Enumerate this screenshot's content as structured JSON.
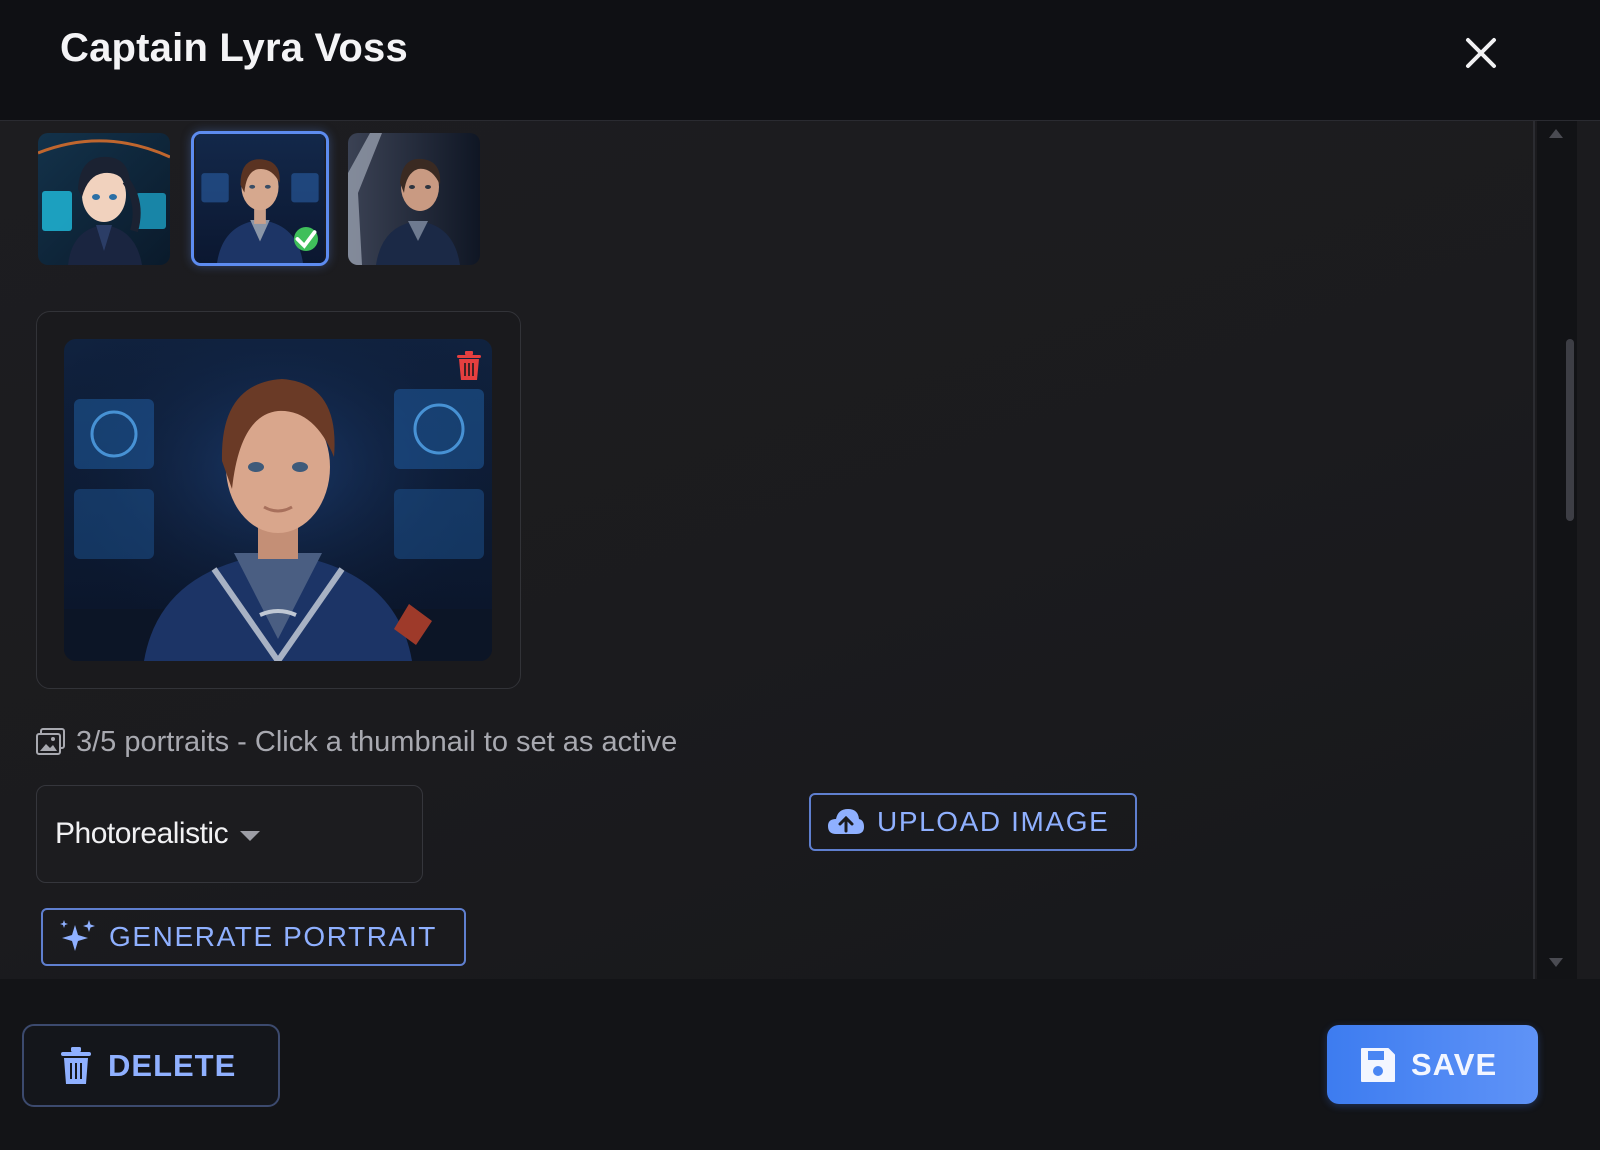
{
  "dialog": {
    "title": "Captain Lyra Voss",
    "close_icon": "close-icon"
  },
  "portraits": {
    "thumbnails": [
      {
        "style": "anime",
        "active": false
      },
      {
        "style": "photorealistic",
        "active": true
      },
      {
        "style": "cinematic",
        "active": false
      }
    ],
    "count_text": "3/5 portraits - Click a thumbnail to set as active",
    "count_icon": "image-gallery-icon",
    "delete_icon": "trash-icon"
  },
  "style_select": {
    "value": "Photorealistic"
  },
  "actions": {
    "upload_label": "UPLOAD IMAGE",
    "upload_icon": "cloud-upload-icon",
    "generate_label": "GENERATE PORTRAIT",
    "generate_icon": "sparkles-icon"
  },
  "footer": {
    "delete_label": "DELETE",
    "save_label": "SAVE"
  },
  "colors": {
    "accent": "#5d8cf0",
    "button_text": "#8fb0ff",
    "save_bg": "#4a86f3",
    "danger": "#e53f3f",
    "success": "#3fbf5b"
  }
}
